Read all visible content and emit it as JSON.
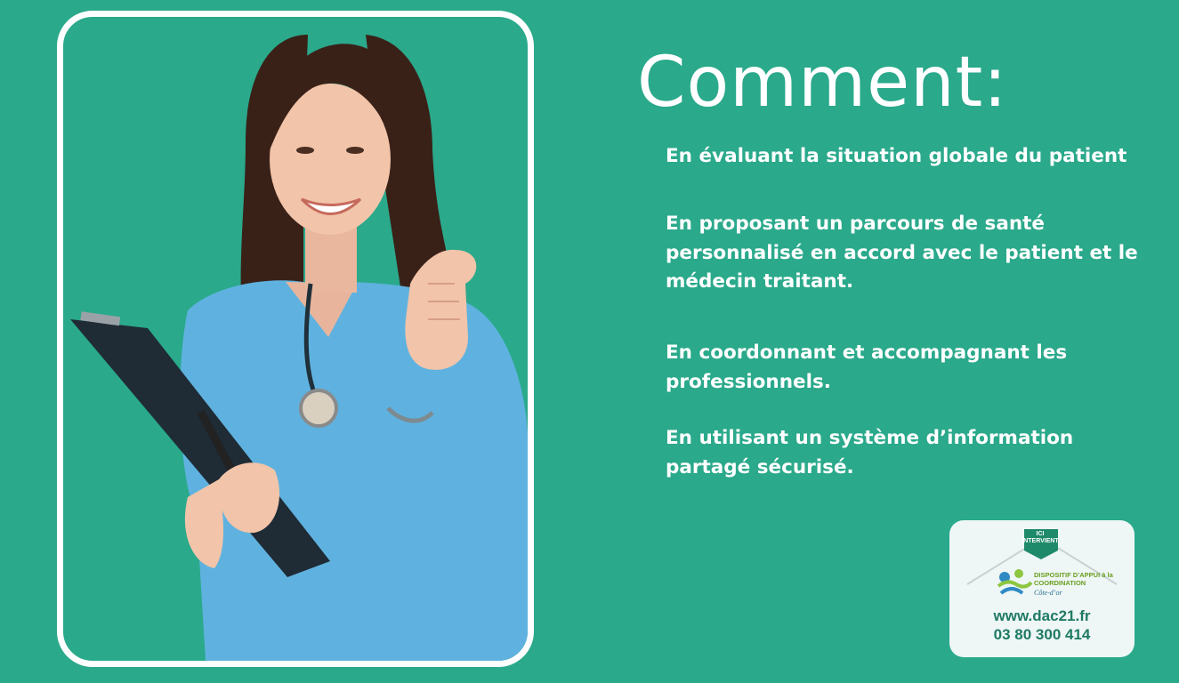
{
  "heading": "Comment:",
  "bullets": [
    "En évaluant la situation globale du patient",
    "En proposant un parcours de santé personnalisé en accord avec le patient et le médecin traitant.",
    "En coordonnant et accompagnant les professionnels.",
    "En utilisant un système d’information partagé sécurisé."
  ],
  "logo": {
    "badge": "ICI INTERVIENT",
    "org_name": "DISPOSITIF D’APPUI à la COORDINATION",
    "region": "Côte-d’or",
    "website": "www.dac21.fr",
    "phone": "03 80 300 414"
  },
  "colors": {
    "background": "#2aa98b",
    "text": "#ffffff",
    "logo_green": "#1f7a63"
  }
}
